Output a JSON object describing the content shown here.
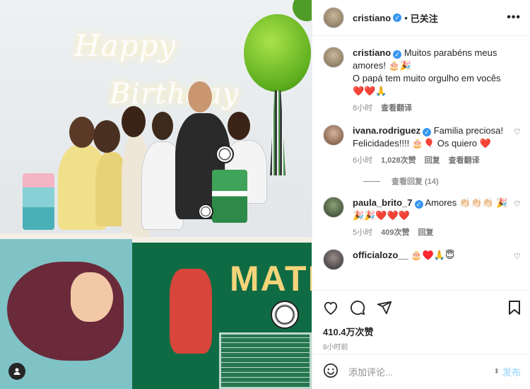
{
  "post": {
    "author": "cristiano",
    "follow_status": "已关注",
    "more": "•••",
    "photo_text": [
      "Happy",
      "Birthday",
      "MATE"
    ]
  },
  "caption": {
    "username": "cristiano",
    "text_1": "Muitos parabéns meus amores! 🎂🎉",
    "text_2": "O papá tem muito orgulho em vocês ❤️❤️🙏",
    "time": "8小时",
    "translate": "查看翻译"
  },
  "comments": [
    {
      "username": "ivana.rodriguez",
      "text": "Familia preciosa! Felicidades!!!! 🎂🎈 Os quiero ❤️",
      "time": "6小时",
      "likes": "1,028次赞",
      "reply": "回复",
      "translate": "查看翻译"
    },
    {
      "username": "paula_brito_7",
      "text": "Amores 👏🏻👏🏻👏🏻 🎉🎉🎉❤️❤️❤️",
      "time": "5小时",
      "likes": "409次赞",
      "reply": "回复"
    },
    {
      "username": "officialozo__",
      "text": "🎂♥️🙏😇"
    }
  ],
  "view_replies": "查看回复 (14)",
  "actions": {
    "likes": "410.4万次赞",
    "time": "8小时前"
  },
  "add_comment": {
    "placeholder": "添加评论...",
    "post": "发布"
  },
  "colors": {
    "verified": "#3897f0",
    "heart": "#ed4956",
    "post_disabled": "#b2dffc"
  }
}
